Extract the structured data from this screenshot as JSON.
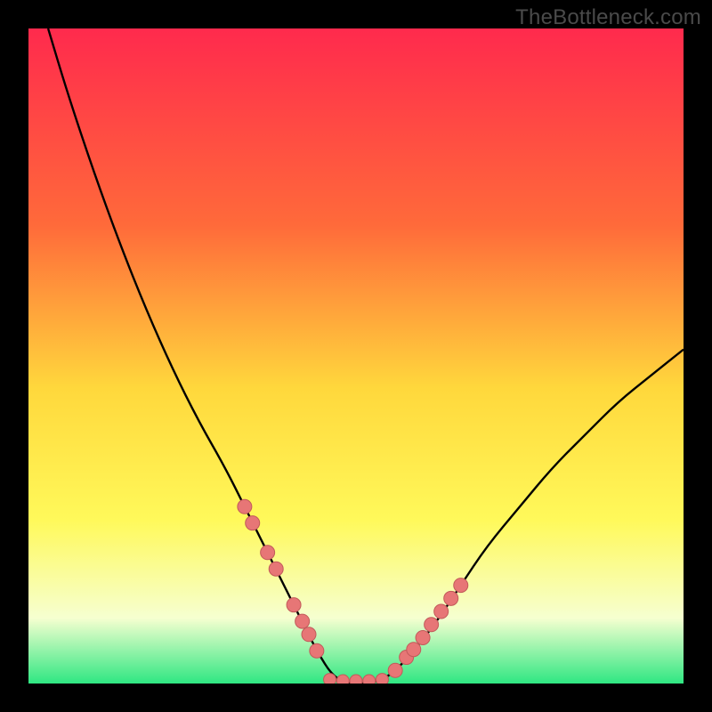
{
  "watermark": "TheBottleneck.com",
  "colors": {
    "frame": "#000000",
    "grad_top": "#ff2a4d",
    "grad_mid1": "#ff6a3a",
    "grad_mid2": "#ffd83c",
    "grad_mid3": "#fff95a",
    "grad_low": "#f6ffd0",
    "grad_bottom": "#2fe782",
    "curve": "#000000",
    "dot_fill": "#e77676",
    "dot_stroke": "#c25a5a"
  },
  "chart_data": {
    "type": "line",
    "title": "",
    "xlabel": "",
    "ylabel": "",
    "xlim": [
      0,
      100
    ],
    "ylim": [
      0,
      100
    ],
    "grid": false,
    "annotations": [
      "TheBottleneck.com"
    ],
    "series": [
      {
        "name": "bottleneck-curve",
        "x": [
          3,
          6,
          10,
          14,
          18,
          22,
          26,
          30,
          33,
          36,
          39,
          41.5,
          44,
          46.5,
          49,
          52,
          55,
          58,
          62,
          66,
          70,
          75,
          80,
          85,
          90,
          95,
          100
        ],
        "y": [
          100,
          90,
          78,
          67,
          57,
          48,
          40,
          33,
          27,
          21,
          15,
          10,
          5,
          1,
          0,
          0,
          1,
          4,
          9,
          15,
          21,
          27,
          33,
          38,
          43,
          47,
          51
        ]
      }
    ],
    "left_dots": {
      "x": [
        33,
        34.2,
        36.5,
        37.8,
        40.5,
        41.8,
        42.8,
        44
      ],
      "y": [
        27,
        24.5,
        20,
        17.5,
        12,
        9.5,
        7.5,
        5
      ]
    },
    "right_dots": {
      "x": [
        56,
        57.7,
        58.8,
        60.2,
        61.5,
        63,
        64.5,
        66
      ],
      "y": [
        2,
        4,
        5.2,
        7,
        9,
        11,
        13,
        15
      ]
    },
    "floor_dots": {
      "x": [
        46,
        48,
        50,
        52,
        54
      ],
      "y": [
        0.6,
        0.4,
        0.4,
        0.4,
        0.6
      ]
    }
  }
}
